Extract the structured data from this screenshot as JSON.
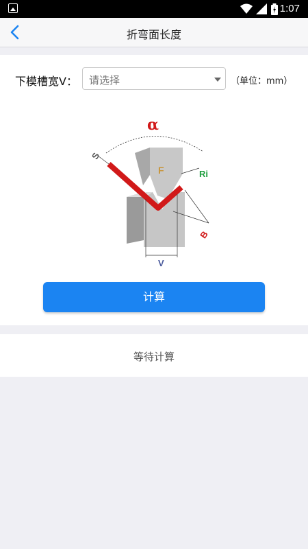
{
  "status": {
    "time": "1:07"
  },
  "navbar": {
    "title": "折弯面长度"
  },
  "form": {
    "label": "下模槽宽V：",
    "select_placeholder": "请选择",
    "unit": "（单位：mm）"
  },
  "diagram": {
    "alpha": "α",
    "s": "S",
    "f": "F",
    "ri": "Ri",
    "b": "B",
    "v": "V"
  },
  "actions": {
    "calculate": "计算"
  },
  "result": {
    "text": "等待计算"
  },
  "colors": {
    "accent": "#1b84f2",
    "sheet": "#d11919",
    "ri": "#1e9e3e",
    "f": "#c8963c",
    "v": "#4a5a9c"
  }
}
